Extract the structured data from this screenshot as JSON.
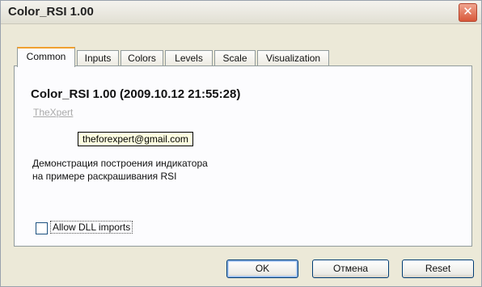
{
  "window": {
    "title": "Color_RSI 1.00",
    "close_glyph": "✕"
  },
  "tabs": [
    {
      "label": "Common",
      "active": true
    },
    {
      "label": "Inputs",
      "active": false
    },
    {
      "label": "Colors",
      "active": false
    },
    {
      "label": "Levels",
      "active": false
    },
    {
      "label": "Scale",
      "active": false
    },
    {
      "label": "Visualization",
      "active": false
    }
  ],
  "common": {
    "indicator_title": "Color_RSI 1.00  (2009.10.12 21:55:28)",
    "author": "TheXpert",
    "author_email_tooltip": "theforexpert@gmail.com",
    "description_lines": [
      "Демонстрация построения индикатора",
      "на примере раскрашивания RSI"
    ],
    "allow_dll": {
      "label": "Allow DLL imports",
      "checked": false
    }
  },
  "buttons": {
    "ok": "OK",
    "cancel": "Отмена",
    "reset": "Reset"
  },
  "colors": {
    "active_tab_accent": "#f0a030",
    "close_button": "#d8583a",
    "dialog_background": "#ece9d8"
  }
}
